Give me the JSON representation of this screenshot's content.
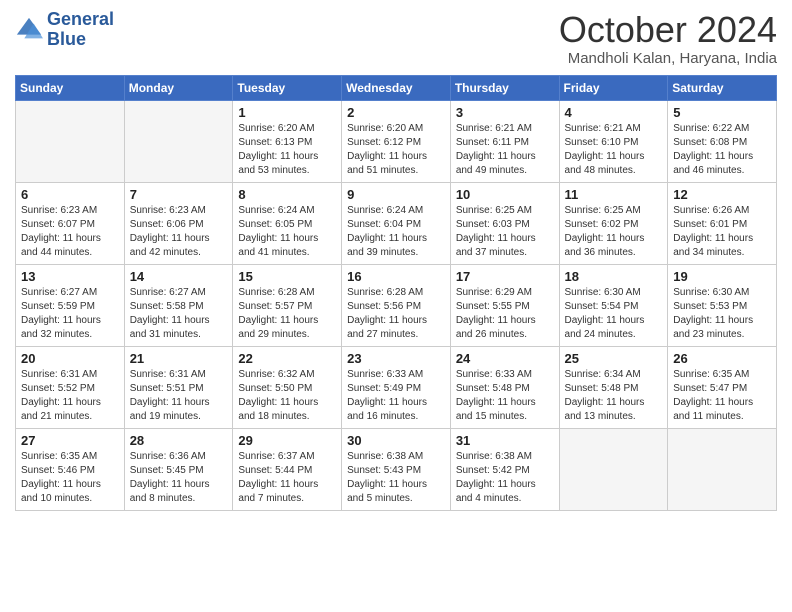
{
  "header": {
    "logo_line1": "General",
    "logo_line2": "Blue",
    "month_year": "October 2024",
    "location": "Mandholi Kalan, Haryana, India"
  },
  "weekdays": [
    "Sunday",
    "Monday",
    "Tuesday",
    "Wednesday",
    "Thursday",
    "Friday",
    "Saturday"
  ],
  "weeks": [
    [
      {
        "day": "",
        "info": ""
      },
      {
        "day": "",
        "info": ""
      },
      {
        "day": "1",
        "info": "Sunrise: 6:20 AM\nSunset: 6:13 PM\nDaylight: 11 hours and 53 minutes."
      },
      {
        "day": "2",
        "info": "Sunrise: 6:20 AM\nSunset: 6:12 PM\nDaylight: 11 hours and 51 minutes."
      },
      {
        "day": "3",
        "info": "Sunrise: 6:21 AM\nSunset: 6:11 PM\nDaylight: 11 hours and 49 minutes."
      },
      {
        "day": "4",
        "info": "Sunrise: 6:21 AM\nSunset: 6:10 PM\nDaylight: 11 hours and 48 minutes."
      },
      {
        "day": "5",
        "info": "Sunrise: 6:22 AM\nSunset: 6:08 PM\nDaylight: 11 hours and 46 minutes."
      }
    ],
    [
      {
        "day": "6",
        "info": "Sunrise: 6:23 AM\nSunset: 6:07 PM\nDaylight: 11 hours and 44 minutes."
      },
      {
        "day": "7",
        "info": "Sunrise: 6:23 AM\nSunset: 6:06 PM\nDaylight: 11 hours and 42 minutes."
      },
      {
        "day": "8",
        "info": "Sunrise: 6:24 AM\nSunset: 6:05 PM\nDaylight: 11 hours and 41 minutes."
      },
      {
        "day": "9",
        "info": "Sunrise: 6:24 AM\nSunset: 6:04 PM\nDaylight: 11 hours and 39 minutes."
      },
      {
        "day": "10",
        "info": "Sunrise: 6:25 AM\nSunset: 6:03 PM\nDaylight: 11 hours and 37 minutes."
      },
      {
        "day": "11",
        "info": "Sunrise: 6:25 AM\nSunset: 6:02 PM\nDaylight: 11 hours and 36 minutes."
      },
      {
        "day": "12",
        "info": "Sunrise: 6:26 AM\nSunset: 6:01 PM\nDaylight: 11 hours and 34 minutes."
      }
    ],
    [
      {
        "day": "13",
        "info": "Sunrise: 6:27 AM\nSunset: 5:59 PM\nDaylight: 11 hours and 32 minutes."
      },
      {
        "day": "14",
        "info": "Sunrise: 6:27 AM\nSunset: 5:58 PM\nDaylight: 11 hours and 31 minutes."
      },
      {
        "day": "15",
        "info": "Sunrise: 6:28 AM\nSunset: 5:57 PM\nDaylight: 11 hours and 29 minutes."
      },
      {
        "day": "16",
        "info": "Sunrise: 6:28 AM\nSunset: 5:56 PM\nDaylight: 11 hours and 27 minutes."
      },
      {
        "day": "17",
        "info": "Sunrise: 6:29 AM\nSunset: 5:55 PM\nDaylight: 11 hours and 26 minutes."
      },
      {
        "day": "18",
        "info": "Sunrise: 6:30 AM\nSunset: 5:54 PM\nDaylight: 11 hours and 24 minutes."
      },
      {
        "day": "19",
        "info": "Sunrise: 6:30 AM\nSunset: 5:53 PM\nDaylight: 11 hours and 23 minutes."
      }
    ],
    [
      {
        "day": "20",
        "info": "Sunrise: 6:31 AM\nSunset: 5:52 PM\nDaylight: 11 hours and 21 minutes."
      },
      {
        "day": "21",
        "info": "Sunrise: 6:31 AM\nSunset: 5:51 PM\nDaylight: 11 hours and 19 minutes."
      },
      {
        "day": "22",
        "info": "Sunrise: 6:32 AM\nSunset: 5:50 PM\nDaylight: 11 hours and 18 minutes."
      },
      {
        "day": "23",
        "info": "Sunrise: 6:33 AM\nSunset: 5:49 PM\nDaylight: 11 hours and 16 minutes."
      },
      {
        "day": "24",
        "info": "Sunrise: 6:33 AM\nSunset: 5:48 PM\nDaylight: 11 hours and 15 minutes."
      },
      {
        "day": "25",
        "info": "Sunrise: 6:34 AM\nSunset: 5:48 PM\nDaylight: 11 hours and 13 minutes."
      },
      {
        "day": "26",
        "info": "Sunrise: 6:35 AM\nSunset: 5:47 PM\nDaylight: 11 hours and 11 minutes."
      }
    ],
    [
      {
        "day": "27",
        "info": "Sunrise: 6:35 AM\nSunset: 5:46 PM\nDaylight: 11 hours and 10 minutes."
      },
      {
        "day": "28",
        "info": "Sunrise: 6:36 AM\nSunset: 5:45 PM\nDaylight: 11 hours and 8 minutes."
      },
      {
        "day": "29",
        "info": "Sunrise: 6:37 AM\nSunset: 5:44 PM\nDaylight: 11 hours and 7 minutes."
      },
      {
        "day": "30",
        "info": "Sunrise: 6:38 AM\nSunset: 5:43 PM\nDaylight: 11 hours and 5 minutes."
      },
      {
        "day": "31",
        "info": "Sunrise: 6:38 AM\nSunset: 5:42 PM\nDaylight: 11 hours and 4 minutes."
      },
      {
        "day": "",
        "info": ""
      },
      {
        "day": "",
        "info": ""
      }
    ]
  ]
}
